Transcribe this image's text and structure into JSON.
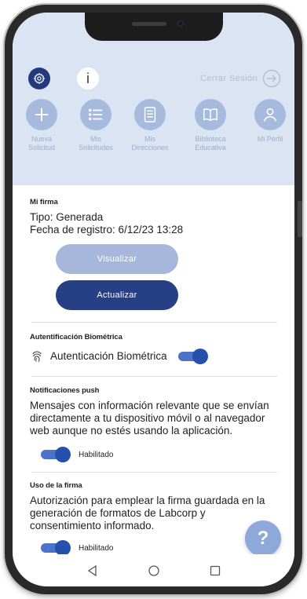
{
  "header": {
    "logout_label": "Cerrar Sesión",
    "info_label": "i"
  },
  "shortcuts": [
    {
      "line1": "Nueva",
      "line2": "Solicitud",
      "icon": "plus-icon"
    },
    {
      "line1": "Mis",
      "line2": "Solicitudes",
      "icon": "list-icon"
    },
    {
      "line1": "Mis",
      "line2": "Direcciones",
      "icon": "document-icon"
    },
    {
      "line1": "Biblioteca",
      "line2": "Educativa",
      "icon": "book-icon"
    },
    {
      "line1": "Mi Perfil",
      "line2": "",
      "icon": "user-icon"
    }
  ],
  "firma": {
    "title": "Mi firma",
    "tipo": "Tipo: Generada",
    "fecha": "Fecha de registro: 6/12/23 13:28",
    "visualizar": "Visualizar",
    "actualizar": "Actualizar"
  },
  "biometrica": {
    "title": "Autentificación Biométrica",
    "label": "Autenticación Biométrica",
    "enabled": true
  },
  "notificaciones": {
    "title": "Notificaciones push",
    "description": "Mensajes con información relevante que se envían directamente a tu dispositivo móvil o al navegador web aunque no estés usando la aplicación.",
    "toggle_label": "Habilitado",
    "enabled": true
  },
  "uso_firma": {
    "title": "Uso de la firma",
    "description": "Autorización para emplear la firma guardada en la generación de formatos de Labcorp y consentimiento informado.",
    "toggle_label": "Habilitado",
    "enabled": true
  },
  "help_label": "?",
  "colors": {
    "primary_dark": "#263f85",
    "primary_light": "#a7b7dc",
    "header_bg": "#dbe4f2",
    "toggle_on": "#2650ad"
  }
}
